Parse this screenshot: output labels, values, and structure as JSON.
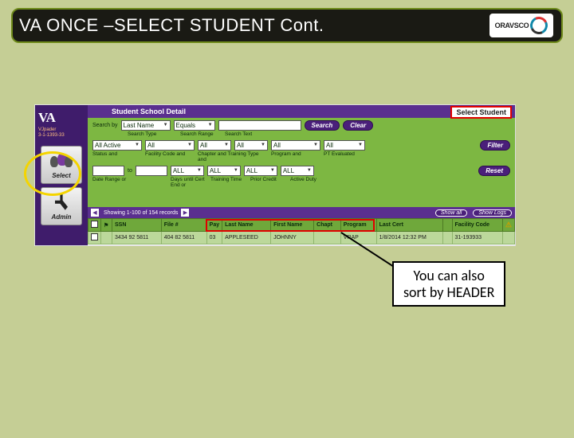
{
  "slide": {
    "title": "VA ONCE –SELECT STUDENT Cont.",
    "logo_text": "ORAVSCO"
  },
  "sidebar": {
    "app_name": "VA",
    "meta_line1": "VJpader",
    "meta_line2": "3-1-1393-33",
    "buttons": [
      {
        "label": "Select"
      },
      {
        "label": "Admin"
      }
    ]
  },
  "main": {
    "header": "Student  School Detail",
    "select_student_flag": "Select Student",
    "search": {
      "by_label": "Search by",
      "by_value": "Last Name",
      "range_value": "Equals",
      "text_value": "",
      "labels": {
        "type": "Search Type",
        "range": "Search Range",
        "text": "Search Text"
      },
      "btn_search": "Search",
      "btn_clear": "Clear"
    },
    "filters_row1": {
      "values": [
        "All Active",
        "All",
        "All",
        "All",
        "All",
        "All"
      ],
      "labels": [
        "Status and",
        "Facility Code and",
        "Chapter and Training Type and",
        "",
        "Program and",
        "PT Evaluated"
      ],
      "btn_filter": "Filter"
    },
    "filters_row2": {
      "left_val": "",
      "to": "to",
      "right_val": "",
      "values": [
        "ALL",
        "ALL",
        "ALL",
        "ALL"
      ],
      "labels": [
        "Date Range or",
        "Days until Cert End or",
        "Training Time",
        "Prior Credit",
        "Active Duty"
      ],
      "btn_reset": "Reset"
    },
    "pager": {
      "showing": "Showing 1-100 of 154 records",
      "btn_show_all": "Show all",
      "btn_show_logs": "Show Logs"
    },
    "table": {
      "headers": [
        "",
        "",
        "SSN",
        "File #",
        "",
        "Last Name",
        "First Name",
        "Chapt",
        "Program",
        "Last Cert",
        "",
        "Facility Code",
        ""
      ],
      "pay_hdr": "Pay",
      "row": {
        "ssn": "3434 92 5811",
        "file": "404 82 5811",
        "pay": "03",
        "last": "APPLESEED",
        "first": "JOHNNY",
        "chapt": "",
        "program": "VRAP",
        "last_cert": "1/8/2014 12:32 PM",
        "facility": "31-193933"
      }
    }
  },
  "callout": {
    "line1": "You can also",
    "line2": "sort by HEADER"
  }
}
